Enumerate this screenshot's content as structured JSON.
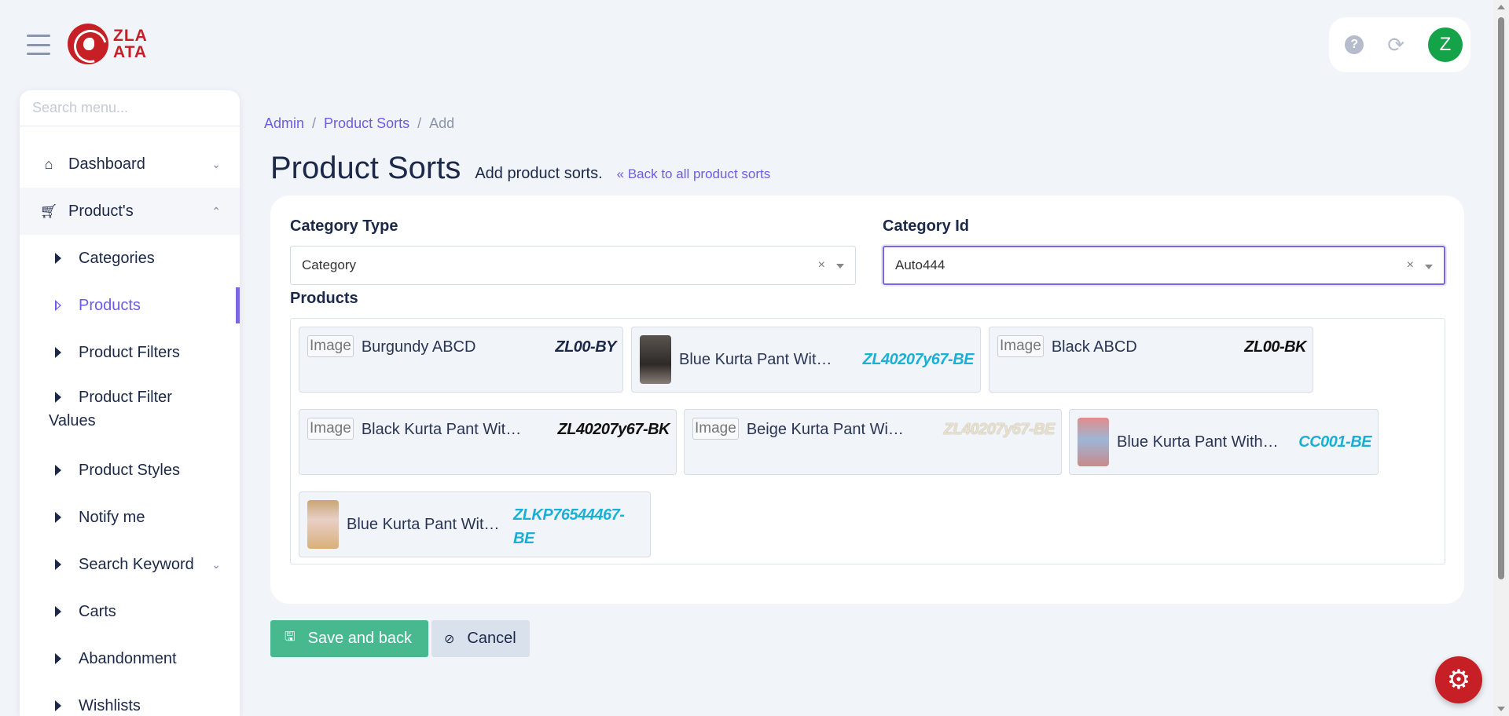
{
  "brand": {
    "logo_line1": "ZLA",
    "logo_line2": "ATA",
    "color": "#c62026"
  },
  "topbar": {
    "help_icon": "question-circle-icon",
    "refresh_icon": "refresh-icon",
    "avatar_letter": "Z",
    "avatar_color": "#15a34a"
  },
  "sidebar": {
    "search_placeholder": "Search menu...",
    "items": [
      {
        "label": "Dashboard",
        "icon": "home-icon"
      },
      {
        "label": "Product's",
        "icon": "cart-icon"
      }
    ],
    "sub_items": [
      {
        "label": "Categories"
      },
      {
        "label": "Products"
      },
      {
        "label": "Product Filters"
      },
      {
        "label": "Product Filter",
        "label2": "Values"
      },
      {
        "label": "Product Styles"
      },
      {
        "label": "Notify me"
      },
      {
        "label": "Search Keyword"
      },
      {
        "label": "Carts"
      },
      {
        "label": "Abandonment"
      },
      {
        "label": "Wishlists"
      }
    ],
    "active_color": "#6b5ce7"
  },
  "breadcrumb": {
    "admin": "Admin",
    "product_sorts": "Product Sorts",
    "current": "Add",
    "sep": "/"
  },
  "page": {
    "title": "Product Sorts",
    "subtitle": "Add product sorts.",
    "back_link": "« Back to all product sorts"
  },
  "form": {
    "category_type": {
      "label": "Category Type",
      "value": "Category"
    },
    "category_id": {
      "label": "Category Id",
      "value": "Auto444"
    },
    "clear_glyph": "×",
    "products_label": "Products",
    "image_alt": "Image",
    "products": [
      {
        "name": "Burgundy ABCD",
        "sku": "ZL00-BY",
        "sku_color": "#1c2848",
        "has_image": false
      },
      {
        "name": "Blue Kurta Pant With …",
        "sku": "ZL40207y67-BE",
        "sku_color": "#1ab0d6",
        "has_image": true
      },
      {
        "name": "Black ABCD",
        "sku": "ZL00-BK",
        "sku_color": "#111111",
        "has_image": false
      },
      {
        "name": "Black Kurta Pant Wit…",
        "sku": "ZL40207y67-BK",
        "sku_color": "#111111",
        "has_image": false
      },
      {
        "name": "Beige Kurta Pant Wit…",
        "sku": "ZL40207y67-BE",
        "sku_color": "#e9e0c8",
        "has_image": false
      },
      {
        "name": "Blue Kurta Pant With …",
        "sku": "CC001-BE",
        "sku_color": "#1ab0d6",
        "has_image": true
      },
      {
        "name": "Blue Kurta Pant Wit…",
        "sku": "ZLKP76544467-",
        "sku2": "BE",
        "sku_color": "#1ab0d6",
        "has_image": true
      }
    ]
  },
  "buttons": {
    "save": "Save and back",
    "cancel": "Cancel",
    "save_color": "#48b98f"
  }
}
